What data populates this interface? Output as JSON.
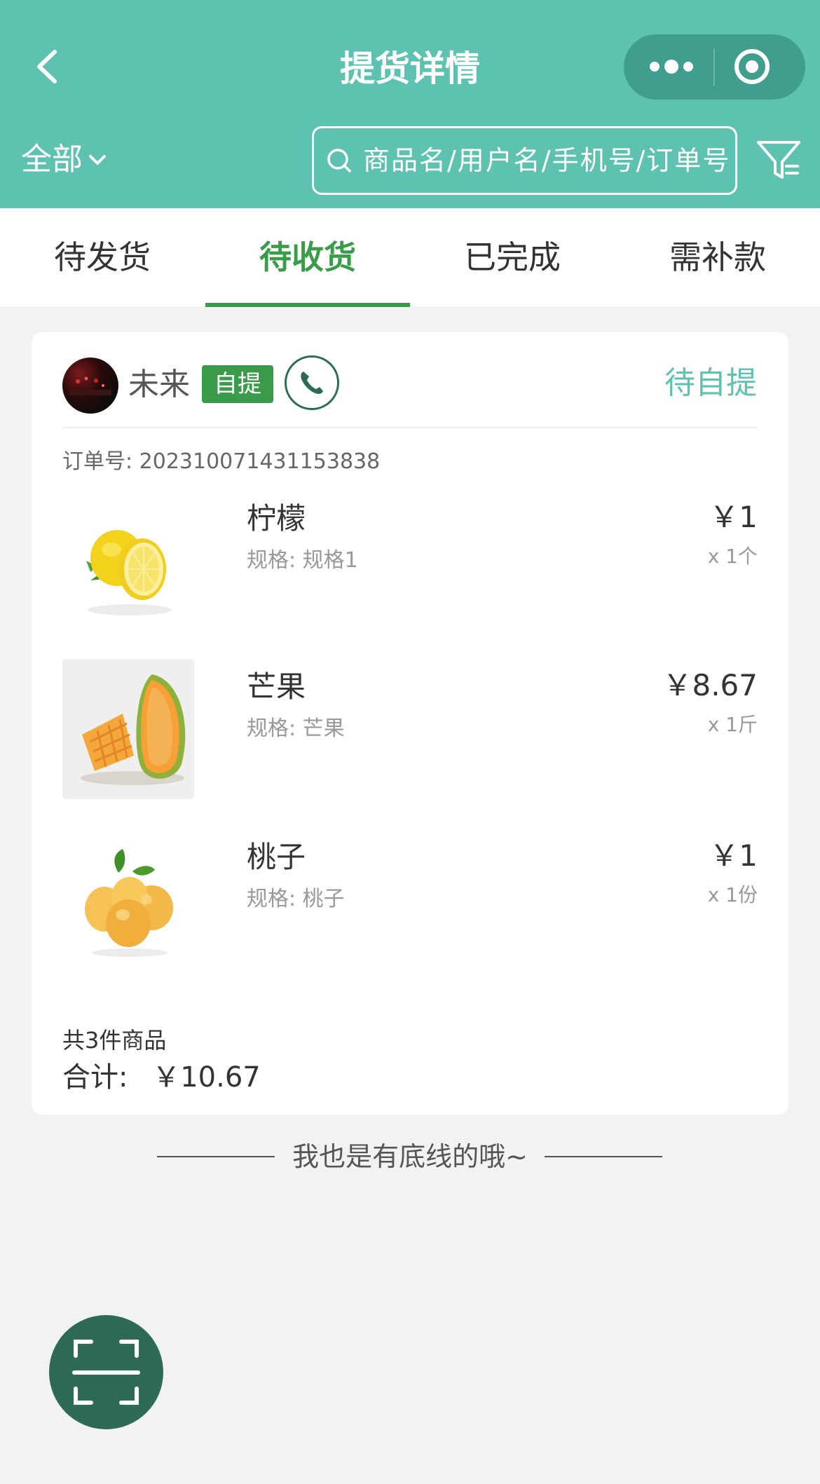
{
  "header": {
    "title": "提货详情",
    "back_icon": "back-icon",
    "more_icon": "more-icon",
    "close_icon": "target-icon",
    "background": "#5ec2b0"
  },
  "filter": {
    "scope": "全部",
    "search_placeholder": "商品名/用户名/手机号/订单号",
    "filter_icon": "filter-icon"
  },
  "tabs": [
    {
      "label": "待发货",
      "active": false
    },
    {
      "label": "待收货",
      "active": true
    },
    {
      "label": "已完成",
      "active": false
    },
    {
      "label": "需补款",
      "active": false
    }
  ],
  "order": {
    "user_name": "未来",
    "pickup_tag": "自提",
    "status": "待自提",
    "order_no_label": "订单号:",
    "order_no": "202310071431153838",
    "products": [
      {
        "name": "柠檬",
        "spec": "规格: 规格1",
        "price": "￥1",
        "qty": "x 1个",
        "image": "lemon"
      },
      {
        "name": "芒果",
        "spec": "规格: 芒果",
        "price": "￥8.67",
        "qty": "x 1斤",
        "image": "mango"
      },
      {
        "name": "桃子",
        "spec": "规格: 桃子",
        "price": "￥1",
        "qty": "x 1份",
        "image": "peach"
      }
    ],
    "item_count": "共3件商品",
    "total_label": "合计:",
    "total": "￥10.67"
  },
  "footer": {
    "bottom_text": "我也是有底线的哦~",
    "scan_icon": "scan-icon"
  },
  "colors": {
    "accent_green": "#3a9b4a",
    "teal": "#5ec2b0",
    "dark_green": "#2e6b55"
  }
}
